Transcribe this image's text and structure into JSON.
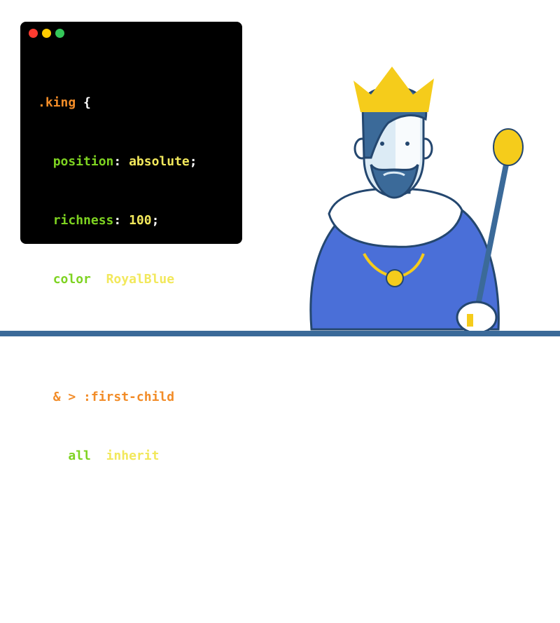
{
  "colors": {
    "window_bg": "#000000",
    "dot_red": "#ff3b30",
    "dot_yellow": "#ffcc00",
    "dot_green": "#34c759",
    "selector": "#f28c28",
    "property": "#7ed321",
    "value": "#f2e85c",
    "royal_blue": "#4a6fd8",
    "gold": "#f5cc1b",
    "floor": "#3b6a99"
  },
  "code": {
    "line1": {
      "selector": ".king",
      "brace": " {"
    },
    "line2": {
      "prop": "position",
      "value": "absolute"
    },
    "line3": {
      "prop": "richness",
      "value": "100"
    },
    "line4": {
      "prop": "color",
      "value": "RoyalBlue"
    },
    "line6": {
      "selector": "& > :first-child",
      "brace": " {"
    },
    "line7": {
      "prop": "all",
      "value": "inherit"
    },
    "line8": {
      "brace": "}"
    },
    "line9": {
      "brace": "}"
    }
  },
  "illustration": {
    "icons": [
      "crown-icon",
      "scepter-icon"
    ]
  }
}
